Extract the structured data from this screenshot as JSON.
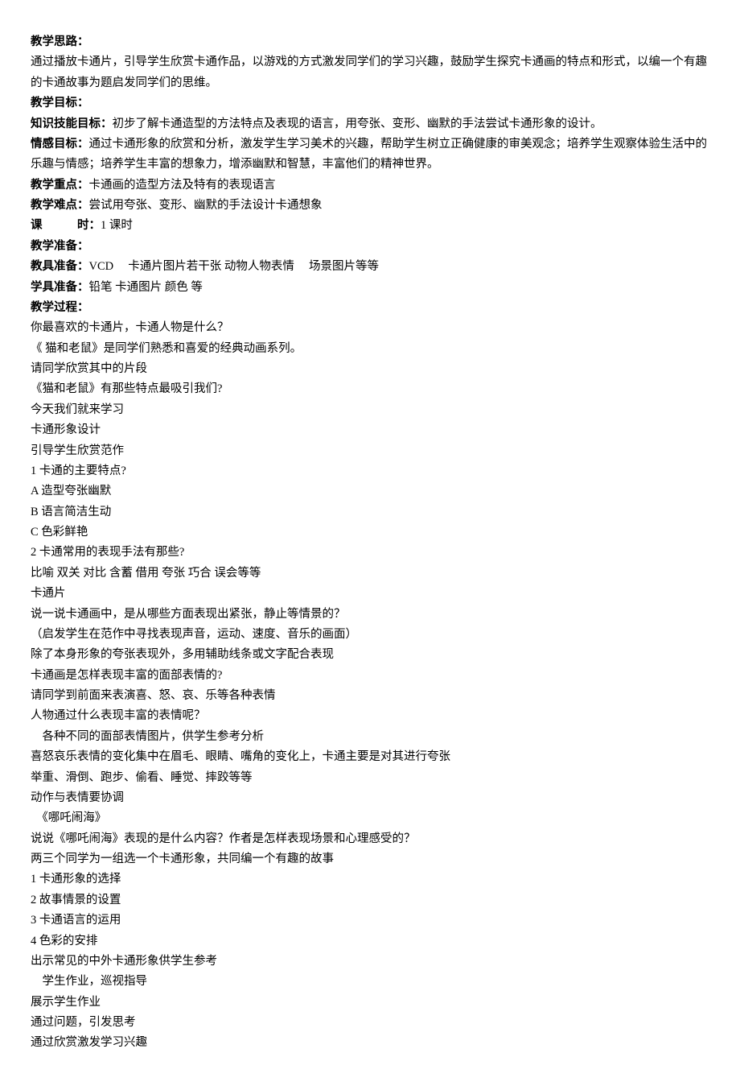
{
  "sections": {
    "s1_label": "教学思路：",
    "s1_body": "通过播放卡通片，引导学生欣赏卡通作品，以游戏的方式激发同学们的学习兴趣，鼓励学生探究卡通画的特点和形式，以编一个有趣的卡通故事为题启发同学们的思维。",
    "s2_label": "教学目标：",
    "s3_label": "知识技能目标：",
    "s3_body": "初步了解卡通造型的方法特点及表现的语言，用夸张、变形、幽默的手法尝试卡通形象的设计。",
    "s4_label": "情感目标：",
    "s4_body": "通过卡通形象的欣赏和分析，激发学生学习美术的兴趣，帮助学生树立正确健康的审美观念；培养学生观察体验生活中的乐趣与情感；培养学生丰富的想象力，增添幽默和智慧，丰富他们的精神世界。",
    "s5_label": "教学重点：",
    "s5_body": "卡通画的造型方法及特有的表现语言",
    "s6_label": "教学难点：",
    "s6_body": "尝试用夸张、变形、幽默的手法设计卡通想象",
    "s7_label": "课　　　时：",
    "s7_body": "1 课时",
    "s8_label": "教学准备：",
    "s9_label": "教具准备：",
    "s9_body": "VCD　 卡通片图片若干张 动物人物表情　 场景图片等等",
    "s10_label": "学具准备：",
    "s10_body": "铅笔 卡通图片 颜色 等",
    "s11_label": "教学过程："
  },
  "lines": [
    "你最喜欢的卡通片，卡通人物是什么？",
    "《 猫和老鼠》是同学们熟悉和喜爱的经典动画系列。",
    "请同学欣赏其中的片段",
    "《猫和老鼠》有那些特点最吸引我们?",
    "今天我们就来学习",
    "卡通形象设计",
    "引导学生欣赏范作",
    "1 卡通的主要特点?",
    "A 造型夸张幽默",
    "B 语言简洁生动",
    "C 色彩鲜艳",
    "2 卡通常用的表现手法有那些?",
    "比喻 双关 对比 含蓄 借用 夸张 巧合 误会等等",
    "卡通片",
    "说一说卡通画中，是从哪些方面表现出紧张，静止等情景的？",
    "（启发学生在范作中寻找表现声音，运动、速度、音乐的画面）",
    "除了本身形象的夸张表现外，多用辅助线条或文字配合表现",
    "卡通画是怎样表现丰富的面部表情的?",
    "请同学到前面来表演喜、怒、哀、乐等各种表情",
    "人物通过什么表现丰富的表情呢？",
    "　各种不同的面部表情图片，供学生参考分析",
    "喜怒哀乐表情的变化集中在眉毛、眼睛、嘴角的变化上，卡通主要是对其进行夸张",
    "举重、滑倒、跑步、偷看、睡觉、摔跤等等",
    "动作与表情要协调",
    "　《哪吒闹海》",
    "说说《哪吒闹海》表现的是什么内容？作者是怎样表现场景和心理感受的？",
    "两三个同学为一组选一个卡通形象，共同编一个有趣的故事",
    "1 卡通形象的选择",
    "2 故事情景的设置",
    "3 卡通语言的运用",
    "4 色彩的安排",
    "出示常见的中外卡通形象供学生参考",
    "　学生作业，巡视指导",
    "展示学生作业",
    "通过问题，引发思考",
    "通过欣赏激发学习兴趣"
  ]
}
